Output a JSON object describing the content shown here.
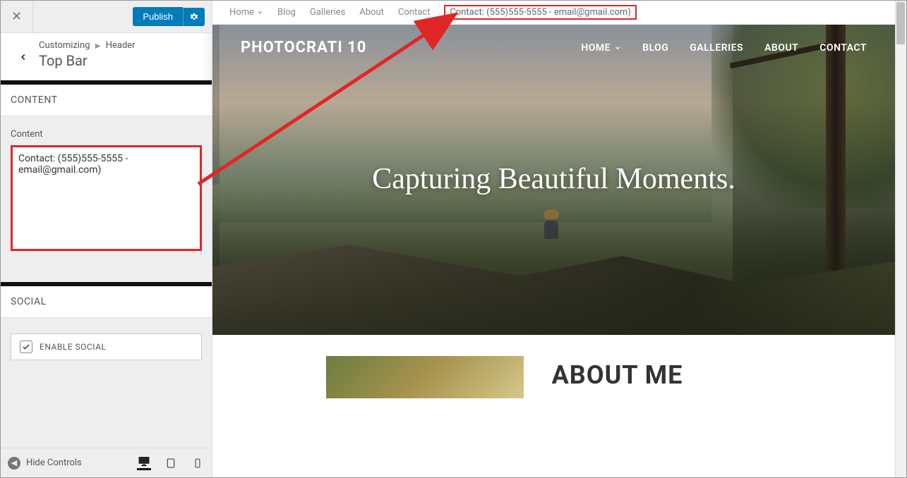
{
  "sidebar": {
    "publish_label": "Publish",
    "breadcrumb_root": "Customizing",
    "breadcrumb_parent": "Header",
    "breadcrumb_title": "Top Bar",
    "content_header": "CONTENT",
    "content_label": "Content",
    "content_value": "Contact: (555)555-5555 - email@gmail.com)",
    "social_header": "SOCIAL",
    "enable_social_label": "ENABLE SOCIAL",
    "enable_social_checked": true,
    "hide_controls_label": "Hide Controls"
  },
  "preview": {
    "topbar": {
      "items": [
        "Home",
        "Blog",
        "Galleries",
        "About",
        "Contact"
      ],
      "contact_text": "Contact: (555)555-5555 - email@gmail.com)"
    },
    "logo": "PHOTOCRATI 10",
    "nav": [
      "HOME",
      "BLOG",
      "GALLERIES",
      "ABOUT",
      "CONTACT"
    ],
    "hero_title": "Capturing Beautiful Moments.",
    "about_title": "ABOUT ME"
  }
}
